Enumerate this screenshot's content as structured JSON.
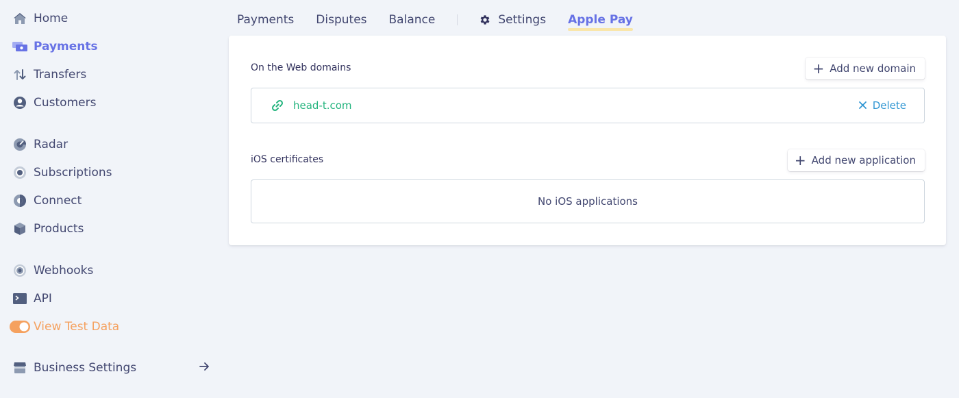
{
  "sidebar": {
    "items": [
      {
        "label": "Home",
        "icon": "home-icon"
      },
      {
        "label": "Payments",
        "icon": "payments-icon"
      },
      {
        "label": "Transfers",
        "icon": "transfers-icon"
      },
      {
        "label": "Customers",
        "icon": "customers-icon"
      },
      {
        "label": "Radar",
        "icon": "radar-icon"
      },
      {
        "label": "Subscriptions",
        "icon": "subscriptions-icon"
      },
      {
        "label": "Connect",
        "icon": "connect-icon"
      },
      {
        "label": "Products",
        "icon": "products-icon"
      },
      {
        "label": "Webhooks",
        "icon": "webhooks-icon"
      },
      {
        "label": "API",
        "icon": "api-icon"
      },
      {
        "label": "View Test Data",
        "icon": "toggle-icon"
      },
      {
        "label": "Business Settings",
        "icon": "business-icon"
      }
    ]
  },
  "tabs": {
    "payments": "Payments",
    "disputes": "Disputes",
    "balance": "Balance",
    "settings": "Settings",
    "apple_pay": "Apple Pay"
  },
  "web_domains": {
    "title": "On the Web domains",
    "add_label": "Add new domain",
    "domains": [
      {
        "name": "head-t.com",
        "delete_label": "Delete"
      }
    ]
  },
  "ios_certificates": {
    "title": "iOS certificates",
    "add_label": "Add new application",
    "empty_text": "No iOS applications"
  },
  "colors": {
    "accent": "#6772e5",
    "success": "#24b47e",
    "link": "#3297d3",
    "test_data": "#f5a15f"
  }
}
